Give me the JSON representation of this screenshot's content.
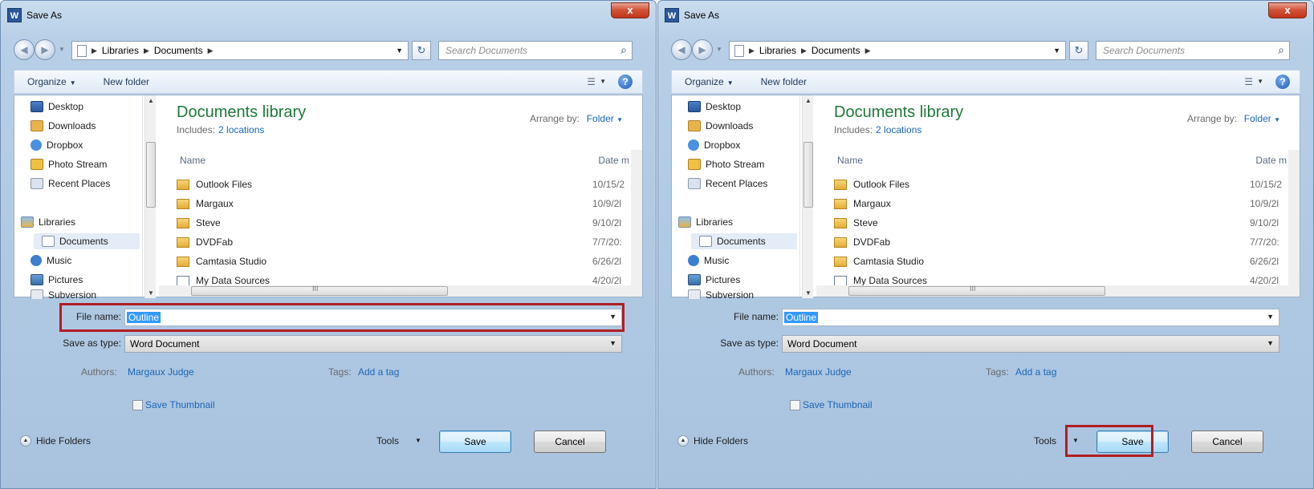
{
  "window": {
    "title": "Save As",
    "app_icon": "W",
    "close_glyph": "x"
  },
  "address": {
    "crumbs": [
      "Libraries",
      "Documents"
    ],
    "search_placeholder": "Search Documents"
  },
  "toolbar": {
    "organize": "Organize",
    "new_folder": "New folder"
  },
  "nav": {
    "favorites": [
      "Desktop",
      "Downloads",
      "Dropbox",
      "Photo Stream",
      "Recent Places"
    ],
    "libraries_label": "Libraries",
    "libraries": [
      "Documents",
      "Music",
      "Pictures",
      "Subversion"
    ]
  },
  "library": {
    "title": "Documents library",
    "includes_label": "Includes:",
    "includes_link": "2 locations",
    "arrange_label": "Arrange by:",
    "arrange_value": "Folder",
    "col_name": "Name",
    "col_date": "Date m",
    "files": [
      {
        "name": "Outlook Files",
        "date": "10/15/2"
      },
      {
        "name": "Margaux",
        "date": "10/9/2l"
      },
      {
        "name": "Steve",
        "date": "9/10/2l"
      },
      {
        "name": "DVDFab",
        "date": "7/7/20:"
      },
      {
        "name": "Camtasia Studio",
        "date": "6/26/2l"
      },
      {
        "name": "My Data Sources",
        "date": "4/20/2l"
      }
    ]
  },
  "form": {
    "filename_label": "File name:",
    "filename_value": "Outline",
    "savetype_label": "Save as type:",
    "savetype_value": "Word Document",
    "authors_label": "Authors:",
    "authors_value": "Margaux Judge",
    "tags_label": "Tags:",
    "tags_value": "Add a tag",
    "thumbnail_label": "Save Thumbnail"
  },
  "footer": {
    "hide_folders": "Hide Folders",
    "tools": "Tools",
    "save": "Save",
    "cancel": "Cancel"
  },
  "colors": {
    "highlight": "#b01e22",
    "library_title": "#1e7a3a",
    "link": "#1a66b8"
  }
}
